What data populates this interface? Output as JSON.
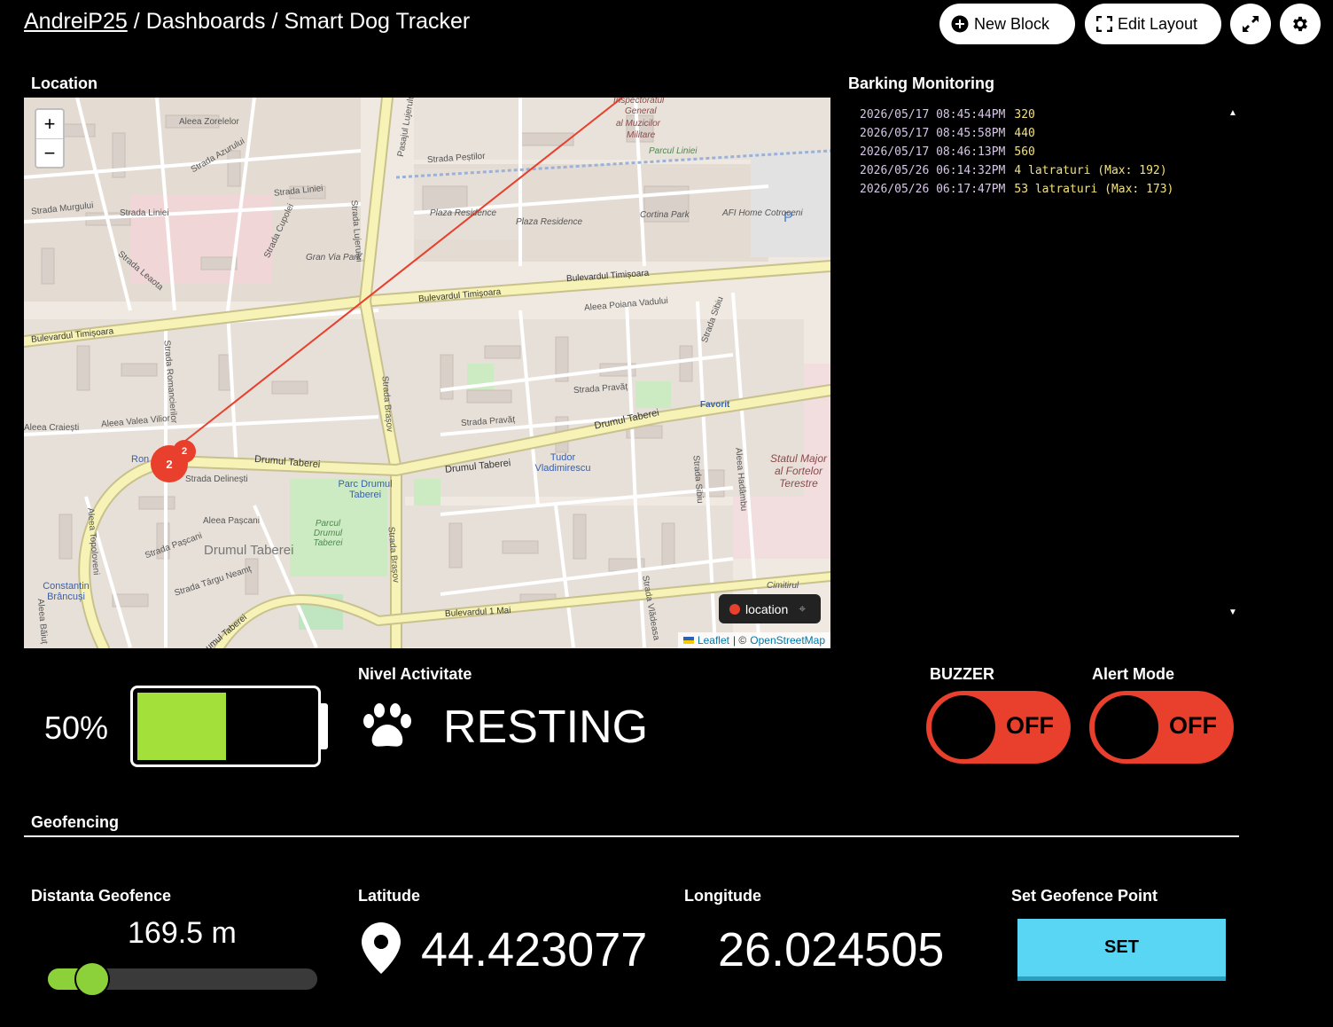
{
  "breadcrumb": {
    "user": "AndreiP25",
    "sep": "/",
    "dashboards": "Dashboards",
    "current": "Smart Dog Tracker"
  },
  "header": {
    "new_block": "New Block",
    "edit_layout": "Edit Layout"
  },
  "location": {
    "title": "Location",
    "zoom_in": "+",
    "zoom_out": "−",
    "legend": "location",
    "cluster_count": "2",
    "cluster_count_small": "2",
    "attribution_leaflet": "Leaflet",
    "attribution_sep": "| ©",
    "attribution_osm": "OpenStreetMap",
    "labels": {
      "inspectoratul": "Inspectoratul",
      "general": "General",
      "al_muzicilor": "al Muzicilor",
      "militare": "Militare",
      "aleea_zorelelor": "Aleea Zorelelor",
      "strada_azurului": "Strada Azurului",
      "pasajul_lujerului": "Pasajul Lujerului",
      "strada_pestilor": "Strada Peștilor",
      "parcul_liniei": "Parcul Liniei",
      "strada_murgului": "Strada Murgului",
      "strada_liniei": "Strada Liniei",
      "strada_cupolei": "Strada Cupolei",
      "strada_lujerului": "Strada Lujerului",
      "plaza_residence_1": "Plaza Residence",
      "plaza_residence_2": "Plaza Residence",
      "cortina_park": "Cortina Park",
      "afi_home": "AFI Home Cotroceni",
      "gran_via_park": "Gran Via Park",
      "strada_leaota": "Strada Leaota",
      "bd_timisoara_1": "Bulevardul Timișoara",
      "bd_timisoara_2": "Bulevardul Timișoara",
      "bd_timisoara_3": "Bulevardul Timișoara",
      "aleea_poiana_vadului": "Aleea Poiana Vadului",
      "strada_sibiu_1": "Strada Sibiu",
      "strada_romancierilor": "Strada Romancierilor",
      "strada_brasov_1": "Strada Brașov",
      "strada_pravat_1": "Strada Pravăț",
      "strada_pravat_2": "Strada Pravăț",
      "favorit": "Favorit",
      "aleea_craiesti": "Aleea Craiești",
      "aleea_valea_vilior": "Aleea Valea Vilior",
      "drumul_taberei_1": "Drumul Taberei",
      "drumul_taberei_2": "Drumul Taberei",
      "drumul_taberei_3": "Drumul Taberei",
      "tudor_vladimirescu": "Tudor Vladimirescu",
      "statul_major": "Statul Major al Fortelor Terestre",
      "parc_drumul_taberei": "Parc Drumul Taberei",
      "parcul_drumul_taberei": "Parcul Drumul Taberei",
      "strada_delinesti": "Strada Delinești",
      "aleea_pascani": "Aleea Pașcani",
      "strada_pascani": "Strada Pașcani",
      "drumul_taberei_big": "Drumul Taberei",
      "aleea_topoloven": "Aleea Topoloveni",
      "constantin_brancusi": "Constantin Brâncuși",
      "strada_targu_neamt": "Strada Târgu Neamț",
      "strada_brasov_2": "Strada Brașov",
      "strada_sibiu_2": "Strada Sibiu",
      "aleea_hadambu": "Aleea Hadâmbu",
      "bd_1_mai": "Bulevardul 1 Mai",
      "cimitirul": "Cimitirul",
      "strada_valea": "Strada Vlădeasa",
      "ron": "Ron",
      "aleea_baiut": "Aleea Băiuț",
      "drumul_taberei_4": "umul Taberei",
      "parking": "P"
    }
  },
  "barking": {
    "title": "Barking Monitoring",
    "entries": [
      {
        "ts": "2026/05/17 08:45:44PM",
        "val": "320"
      },
      {
        "ts": "2026/05/17 08:45:58PM",
        "val": "440"
      },
      {
        "ts": "2026/05/17 08:46:13PM",
        "val": "560"
      },
      {
        "ts": "2026/05/26 06:14:32PM",
        "val": "4 latraturi (Max: 192)"
      },
      {
        "ts": "2026/05/26 06:17:47PM",
        "val": "53 latraturi (Max: 173)"
      }
    ],
    "scroll_up": "▲",
    "scroll_down": "▼"
  },
  "battery": {
    "label": "50%",
    "level": 0.5
  },
  "activity": {
    "title": "Nivel Activitate",
    "status": "RESTING"
  },
  "buzzer": {
    "title": "BUZZER",
    "state": "OFF"
  },
  "alert": {
    "title": "Alert Mode",
    "state": "OFF"
  },
  "geofencing": {
    "title": "Geofencing",
    "distance_title": "Distanta Geofence",
    "distance_value": "169.5 m",
    "latitude_title": "Latitude",
    "latitude_value": "44.423077",
    "longitude_title": "Longitude",
    "longitude_value": "26.024505",
    "set_title": "Set Geofence Point",
    "set_label": "SET"
  },
  "colors": {
    "accent_red": "#e8402c",
    "battery_green": "#a3e03a",
    "set_button": "#5ad6f5",
    "slider_green": "#8dd13a"
  },
  "icons": {
    "new_block": "plus-circle-icon",
    "edit_layout": "expand-frame-icon",
    "fullscreen": "fullscreen-icon",
    "settings": "gear-icon",
    "activity": "paw-icon",
    "latitude": "map-pin-icon"
  }
}
